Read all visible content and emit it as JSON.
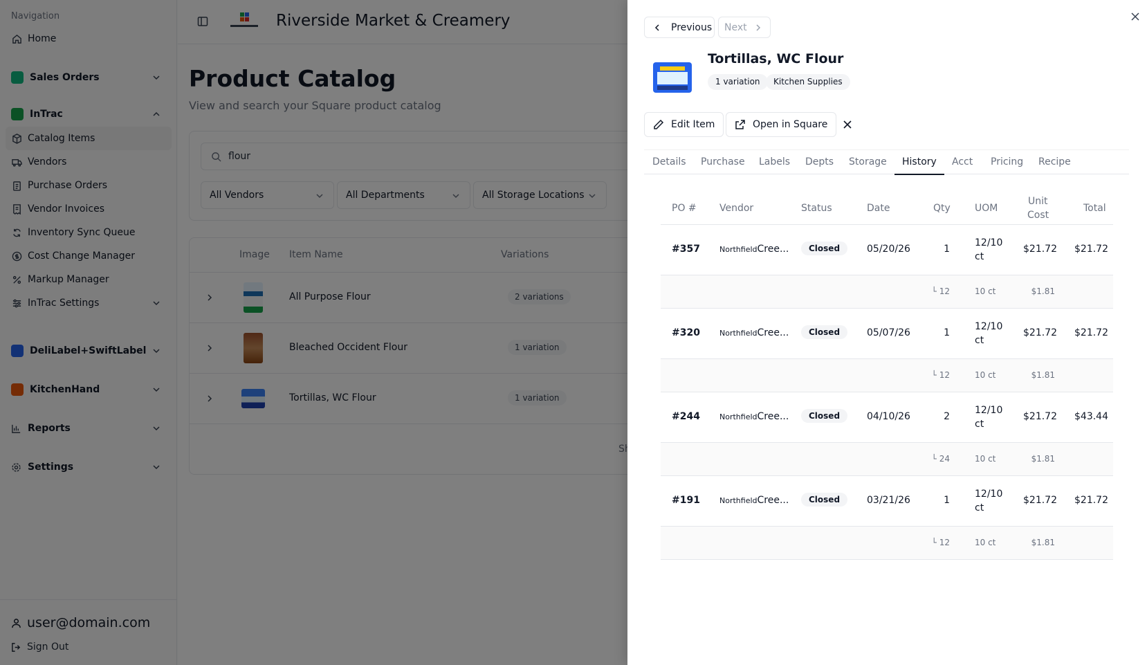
{
  "sidebar": {
    "heading": "Navigation",
    "home": "Home",
    "sales_orders": "Sales Orders",
    "intrac": "InTrac",
    "catalog_items": "Catalog Items",
    "vendors": "Vendors",
    "purchase_orders": "Purchase Orders",
    "vendor_invoices": "Vendor Invoices",
    "inventory_sync": "Inventory Sync Queue",
    "cost_change": "Cost Change Manager",
    "markup": "Markup Manager",
    "intrac_settings": "InTrac Settings",
    "delilabel": "DeliLabel+SwiftLabel",
    "kitchenhand": "KitchenHand",
    "reports": "Reports",
    "settings": "Settings",
    "user": "user@domain.com",
    "sign_out": "Sign Out"
  },
  "header": {
    "store_name": "Riverside Market & Creamery"
  },
  "page": {
    "title": "Product Catalog",
    "subtitle": "View and search your Square product catalog",
    "search_value": "flour",
    "filters": [
      "All Vendors",
      "All Departments",
      "All Storage Locations"
    ]
  },
  "catalog_table": {
    "headers": [
      "Image",
      "Item Name",
      "Variations"
    ],
    "rows": [
      {
        "name": "All Purpose Flour",
        "variations": "2 variations"
      },
      {
        "name": "Bleached Occident Flour",
        "variations": "1 variation"
      },
      {
        "name": "Tortillas, WC Flour",
        "variations": "1 variation"
      }
    ],
    "footer_partial": "Sh"
  },
  "drawer": {
    "prev": "Previous",
    "next": "Next",
    "item_title": "Tortillas, WC Flour",
    "tags": [
      "1 variation",
      "Kitchen Supplies"
    ],
    "edit": "Edit Item",
    "open_square": "Open in Square",
    "tabs": [
      "Details",
      "Purchase",
      "Labels",
      "Depts",
      "Storage",
      "History",
      "Acct",
      "Pricing",
      "Recipe"
    ],
    "active_tab": "History",
    "history": {
      "headers": {
        "po": "PO #",
        "vendor": "Vendor",
        "status": "Status",
        "date": "Date",
        "qty": "Qty",
        "uom": "UOM",
        "unit_cost_1": "Unit",
        "unit_cost_2": "Cost",
        "total": "Total"
      },
      "rows": [
        {
          "po": "#357",
          "vendor_small": "Northfield",
          "vendor": "Cree...",
          "status": "Closed",
          "date": "05/20/26",
          "qty": "1",
          "uom_1": "12/10",
          "uom_2": "ct",
          "unit_cost": "$21.72",
          "total": "$21.72",
          "sub_qty": "12",
          "sub_uom": "10 ct",
          "sub_cost": "$1.81"
        },
        {
          "po": "#320",
          "vendor_small": "Northfield",
          "vendor": "Cree...",
          "status": "Closed",
          "date": "05/07/26",
          "qty": "1",
          "uom_1": "12/10",
          "uom_2": "ct",
          "unit_cost": "$21.72",
          "total": "$21.72",
          "sub_qty": "12",
          "sub_uom": "10 ct",
          "sub_cost": "$1.81"
        },
        {
          "po": "#244",
          "vendor_small": "Northfield",
          "vendor": "Cree...",
          "status": "Closed",
          "date": "04/10/26",
          "qty": "2",
          "uom_1": "12/10",
          "uom_2": "ct",
          "unit_cost": "$21.72",
          "total": "$43.44",
          "sub_qty": "24",
          "sub_uom": "10 ct",
          "sub_cost": "$1.81"
        },
        {
          "po": "#191",
          "vendor_small": "Northfield",
          "vendor": "Cree...",
          "status": "Closed",
          "date": "03/21/26",
          "qty": "1",
          "uom_1": "12/10",
          "uom_2": "ct",
          "unit_cost": "$21.72",
          "total": "$21.72",
          "sub_qty": "12",
          "sub_uom": "10 ct",
          "sub_cost": "$1.81"
        }
      ]
    }
  },
  "colors": {
    "overlay": "#000000",
    "accent_green": "#16a34a",
    "accent_blue": "#2563eb"
  }
}
